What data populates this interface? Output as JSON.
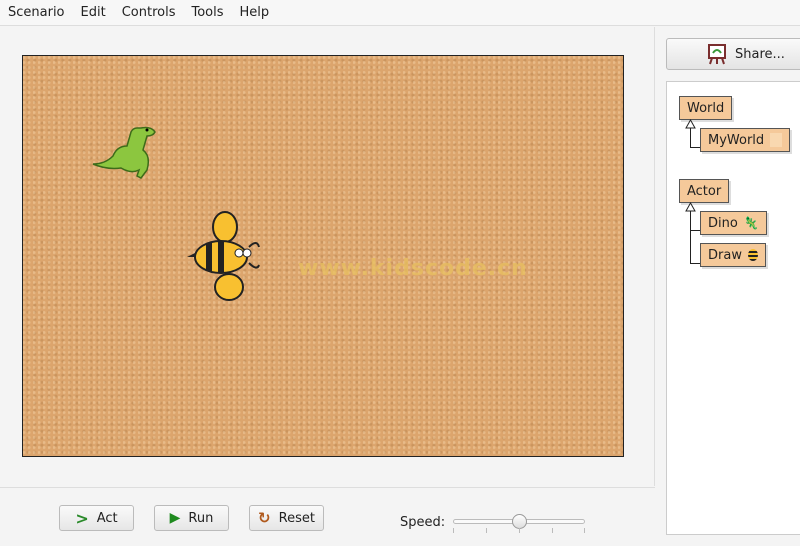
{
  "menu": [
    "Scenario",
    "Edit",
    "Controls",
    "Tools",
    "Help"
  ],
  "world": {
    "watermark": "www.kidscode.cn",
    "actors": [
      "dino",
      "bee"
    ],
    "background_color": "#dca56d"
  },
  "controls": {
    "act": "Act",
    "run": "Run",
    "reset": "Reset",
    "speed_label": "Speed:",
    "speed_value": 50
  },
  "sidebar": {
    "share": "Share...",
    "world_classes": {
      "base": "World",
      "sub": [
        "MyWorld"
      ]
    },
    "actor_classes": {
      "base": "Actor",
      "sub": [
        "Dino",
        "Draw"
      ]
    },
    "class_color": "#f5c99a"
  }
}
